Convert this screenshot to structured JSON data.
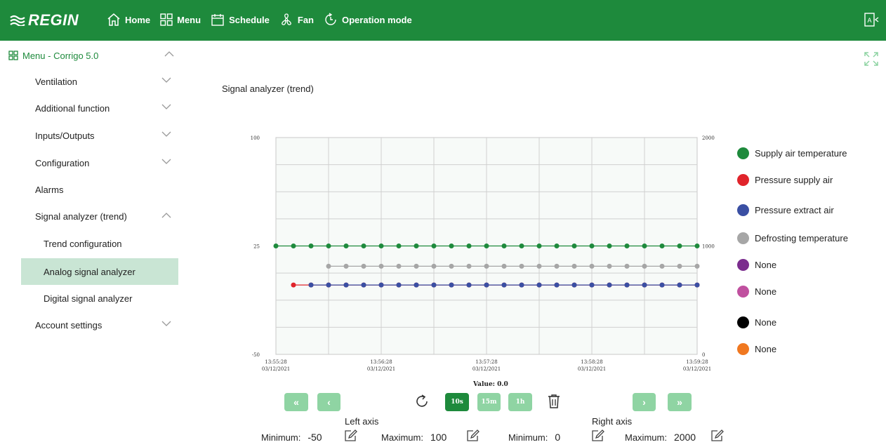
{
  "header": {
    "logo_text": "REGIN",
    "nav": [
      {
        "label": "Home",
        "icon": "home-icon"
      },
      {
        "label": "Menu",
        "icon": "menu-grid-icon"
      },
      {
        "label": "Schedule",
        "icon": "calendar-icon"
      },
      {
        "label": "Fan",
        "icon": "fan-icon"
      },
      {
        "label": "Operation mode",
        "icon": "operation-mode-icon"
      }
    ],
    "right_icon": "logout-icon"
  },
  "sidebar": {
    "title": "Menu - Corrigo 5.0",
    "items": [
      {
        "label": "Ventilation",
        "chevron": "down"
      },
      {
        "label": "Additional function",
        "chevron": "down"
      },
      {
        "label": "Inputs/Outputs",
        "chevron": "down"
      },
      {
        "label": "Configuration",
        "chevron": "down"
      },
      {
        "label": "Alarms",
        "chevron": "none"
      },
      {
        "label": "Signal analyzer (trend)",
        "chevron": "up"
      },
      {
        "label": "Trend configuration",
        "chevron": "none",
        "sub": true
      },
      {
        "label": "Analog signal analyzer",
        "chevron": "none",
        "sub": true,
        "active": true
      },
      {
        "label": "Digital signal analyzer",
        "chevron": "none",
        "sub": true
      },
      {
        "label": "Account settings",
        "chevron": "down"
      }
    ]
  },
  "main": {
    "title": "Signal analyzer (trend)",
    "value_label": "Value: 0.0",
    "buttons": {
      "first": "«",
      "prev": "‹",
      "next": "›",
      "last": "»",
      "range_10s": "10s",
      "range_15m": "15m",
      "range_1h": "1h"
    },
    "left_axis": {
      "title": "Left axis",
      "min_label": "Minimum:",
      "min_value": "-50",
      "max_label": "Maximum:",
      "max_value": "100"
    },
    "right_axis": {
      "title": "Right axis",
      "min_label": "Minimum:",
      "min_value": "0",
      "max_label": "Maximum:",
      "max_value": "2000"
    }
  },
  "legend": [
    {
      "label": "Supply air temperature",
      "color": "#1e8a3c"
    },
    {
      "label": "Pressure supply air",
      "color": "#e0242b"
    },
    {
      "label": "Pressure extract air",
      "color": "#3a4fa3"
    },
    {
      "label": "Defrosting temperature",
      "color": "#a6a6a6"
    },
    {
      "label": "None",
      "color": "#7b2d8e"
    },
    {
      "label": "None",
      "color": "#c0509f"
    },
    {
      "label": "None",
      "color": "#000000"
    },
    {
      "label": "None",
      "color": "#f07820"
    }
  ],
  "chart_data": {
    "type": "line",
    "left_axis_ticks": [
      "100",
      "25",
      "-50"
    ],
    "right_axis_ticks": [
      "2000",
      "1000",
      "0"
    ],
    "ylim_left": [
      -50,
      100
    ],
    "ylim_right": [
      0,
      2000
    ],
    "x_tick_labels": [
      {
        "time": "13:55:28",
        "date": "03/12/2021"
      },
      {
        "time": "13:56:28",
        "date": "03/12/2021"
      },
      {
        "time": "13:57:28",
        "date": "03/12/2021"
      },
      {
        "time": "13:58:28",
        "date": "03/12/2021"
      },
      {
        "time": "13:59:28",
        "date": "03/12/2021"
      }
    ],
    "x_times": [
      "13:55:28",
      "13:55:38",
      "13:55:48",
      "13:55:58",
      "13:56:08",
      "13:56:18",
      "13:56:28",
      "13:56:38",
      "13:56:48",
      "13:56:58",
      "13:57:08",
      "13:57:18",
      "13:57:28",
      "13:57:38",
      "13:57:48",
      "13:57:58",
      "13:58:08",
      "13:58:18",
      "13:58:28",
      "13:58:38",
      "13:58:48",
      "13:58:58",
      "13:59:08",
      "13:59:18",
      "13:59:28"
    ],
    "grid": true,
    "legend_position": "right",
    "series": [
      {
        "name": "Supply air temperature",
        "axis": "left",
        "color": "#1e8a3c",
        "start_index": 0,
        "value": 25
      },
      {
        "name": "Defrosting temperature",
        "axis": "left",
        "color": "#a6a6a6",
        "start_index": 3,
        "value": 11
      },
      {
        "name": "Pressure supply air",
        "axis": "left",
        "color": "#e0242b",
        "start_index": 1,
        "value": -2
      },
      {
        "name": "Pressure extract air",
        "axis": "left",
        "color": "#3a4fa3",
        "start_index": 2,
        "value": -2
      }
    ]
  }
}
